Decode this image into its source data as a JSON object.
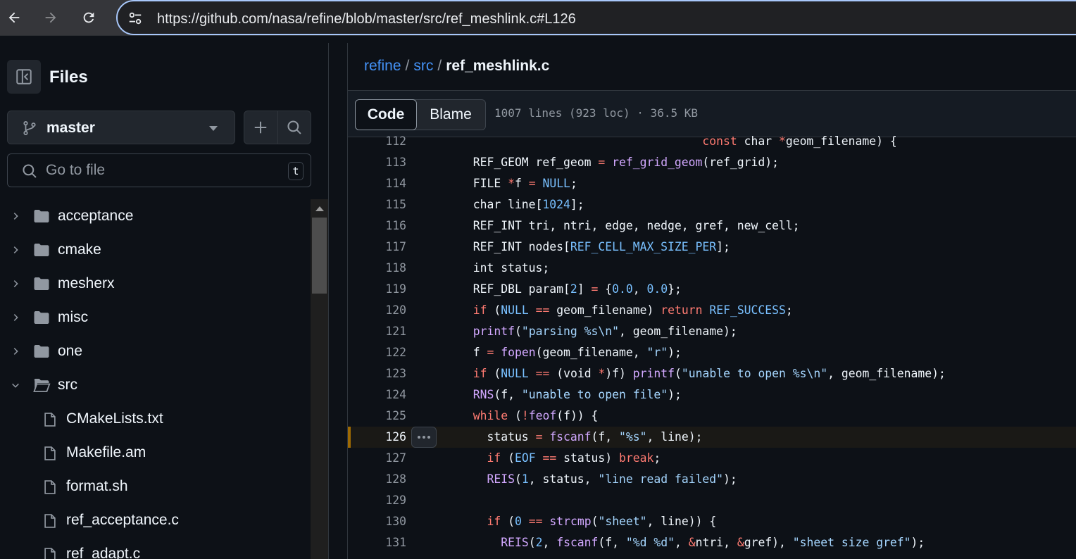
{
  "browser": {
    "url": "https://github.com/nasa/refine/blob/master/src/ref_meshlink.c#L126",
    "back_icon": "arrow-left-icon",
    "forward_icon": "arrow-right-icon",
    "reload_icon": "reload-icon"
  },
  "sidebar": {
    "title": "Files",
    "branch": "master",
    "search_placeholder": "Go to file",
    "search_shortcut": "t",
    "tree": [
      {
        "type": "folder",
        "name": "acceptance",
        "expanded": false
      },
      {
        "type": "folder",
        "name": "cmake",
        "expanded": false
      },
      {
        "type": "folder",
        "name": "mesherx",
        "expanded": false
      },
      {
        "type": "folder",
        "name": "misc",
        "expanded": false
      },
      {
        "type": "folder",
        "name": "one",
        "expanded": false
      },
      {
        "type": "folder",
        "name": "src",
        "expanded": true
      },
      {
        "type": "file",
        "name": "CMakeLists.txt"
      },
      {
        "type": "file",
        "name": "Makefile.am"
      },
      {
        "type": "file",
        "name": "format.sh"
      },
      {
        "type": "file",
        "name": "ref_acceptance.c"
      },
      {
        "type": "file",
        "name": "ref_adapt.c"
      }
    ]
  },
  "main": {
    "breadcrumb": {
      "repo": "refine",
      "dir": "src",
      "file": "ref_meshlink.c",
      "separator": "/"
    },
    "tabs": {
      "code": "Code",
      "blame": "Blame"
    },
    "file_meta": "1007 lines (923 loc) · 36.5 KB",
    "highlighted_line": 126,
    "code_lines": [
      {
        "n": "112",
        "html": "                                   <span class='kw'>const</span> char <span class='kw'>*</span>geom_filename) {"
      },
      {
        "n": "113",
        "html": "  REF_GEOM ref_geom <span class='kw'>=</span> <span class='fn'>ref_grid_geom</span>(ref_grid);"
      },
      {
        "n": "114",
        "html": "  FILE <span class='kw'>*</span>f <span class='kw'>=</span> <span class='cst'>NULL</span>;"
      },
      {
        "n": "115",
        "html": "  char line[<span class='cst'>1024</span>];"
      },
      {
        "n": "116",
        "html": "  REF_INT tri, ntri, edge, nedge, gref, new_cell;"
      },
      {
        "n": "117",
        "html": "  REF_INT nodes[<span class='cst'>REF_CELL_MAX_SIZE_PER</span>];"
      },
      {
        "n": "118",
        "html": "  int status;"
      },
      {
        "n": "119",
        "html": "  REF_DBL param[<span class='cst'>2</span>] <span class='kw'>=</span> {<span class='cst'>0.0</span>, <span class='cst'>0.0</span>};"
      },
      {
        "n": "120",
        "html": "  <span class='kw'>if</span> (<span class='cst'>NULL</span> <span class='kw'>==</span> geom_filename) <span class='kw'>return</span> <span class='cst'>REF_SUCCESS</span>;"
      },
      {
        "n": "121",
        "html": "  <span class='fn'>printf</span>(<span class='str'>\"parsing %s\\n\"</span>, geom_filename);"
      },
      {
        "n": "122",
        "html": "  f <span class='kw'>=</span> <span class='fn'>fopen</span>(geom_filename, <span class='str'>\"r\"</span>);"
      },
      {
        "n": "123",
        "html": "  <span class='kw'>if</span> (<span class='cst'>NULL</span> <span class='kw'>==</span> (void <span class='kw'>*</span>)f) <span class='fn'>printf</span>(<span class='str'>\"unable to open %s\\n\"</span>, geom_filename);"
      },
      {
        "n": "124",
        "html": "  <span class='fn'>RNS</span>(f, <span class='str'>\"unable to open file\"</span>);"
      },
      {
        "n": "125",
        "html": "  <span class='kw'>while</span> (<span class='kw'>!</span><span class='fn'>feof</span>(f)) {"
      },
      {
        "n": "126",
        "html": "    status <span class='kw'>=</span> <span class='fn'>fscanf</span>(f, <span class='str'>\"%s\"</span>, line);"
      },
      {
        "n": "127",
        "html": "    <span class='kw'>if</span> (<span class='cst'>EOF</span> <span class='kw'>==</span> status) <span class='kw'>break</span>;"
      },
      {
        "n": "128",
        "html": "    <span class='fn'>REIS</span>(<span class='cst'>1</span>, status, <span class='str'>\"line read failed\"</span>);"
      },
      {
        "n": "129",
        "html": ""
      },
      {
        "n": "130",
        "html": "    <span class='kw'>if</span> (<span class='cst'>0</span> <span class='kw'>==</span> <span class='fn'>strcmp</span>(<span class='str'>\"sheet\"</span>, line)) {"
      },
      {
        "n": "131",
        "html": "      <span class='fn'>REIS</span>(<span class='cst'>2</span>, <span class='fn'>fscanf</span>(f, <span class='str'>\"%d %d\"</span>, <span class='kw'>&amp;</span>ntri, <span class='kw'>&amp;</span>gref), <span class='str'>\"sheet size gref\"</span>);"
      }
    ]
  }
}
